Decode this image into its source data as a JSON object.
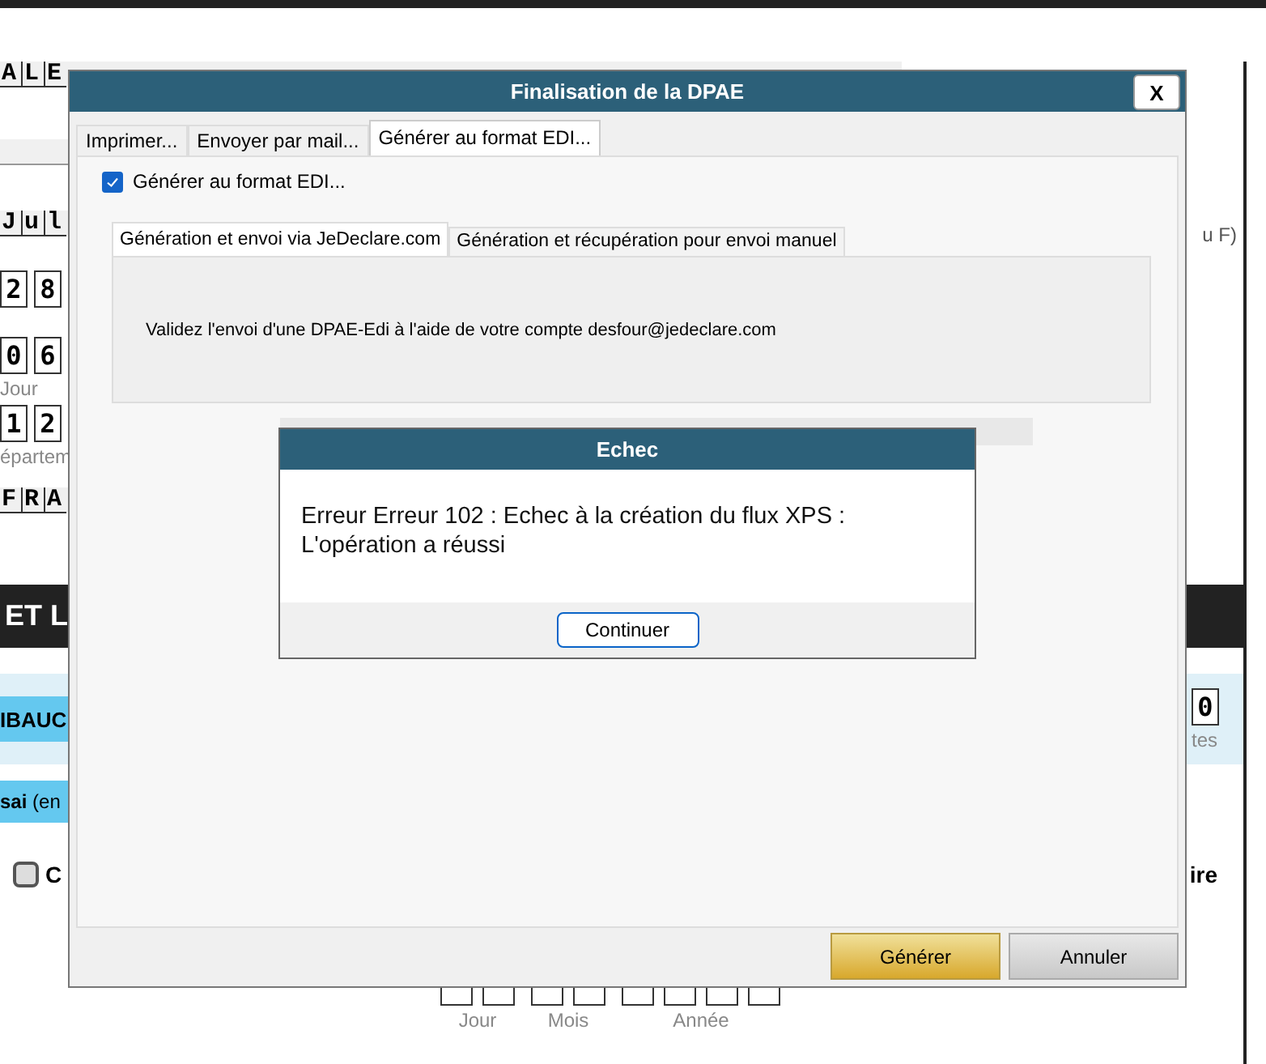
{
  "background": {
    "rows": [
      {
        "kind": "letters",
        "cells": [
          "A",
          "L",
          "E"
        ]
      },
      {
        "kind": "ruler"
      },
      {
        "kind": "letters",
        "cells": [
          "J",
          "u",
          "l"
        ],
        "right": "u F)"
      },
      {
        "kind": "digits",
        "cells": [
          "2",
          "8"
        ]
      },
      {
        "kind": "digits",
        "cells": [
          "0",
          "6"
        ],
        "caption": "Jour"
      },
      {
        "kind": "digits",
        "cells": [
          "1",
          "2"
        ],
        "caption": "épartem"
      },
      {
        "kind": "letters",
        "cells": [
          "F",
          "R",
          "A"
        ]
      },
      {
        "kind": "band",
        "text": "ET L"
      },
      {
        "kind": "blue-band",
        "text": "IBAUC",
        "right_cells": [
          "0"
        ],
        "right_caption": "tes"
      },
      {
        "kind": "blue-bar",
        "text": "**sai** (en"
      },
      {
        "kind": "option",
        "text": "C",
        "checked": false,
        "right": "ire"
      },
      {
        "kind": "date",
        "captions": [
          "Jour",
          "Mois",
          "Année"
        ]
      }
    ]
  },
  "dialog": {
    "title": "Finalisation de la DPAE",
    "close": "X",
    "tabs": [
      {
        "label": "Imprimer...",
        "selected": false
      },
      {
        "label": "Envoyer par mail...",
        "selected": false
      },
      {
        "label": "Générer au format EDI...",
        "selected": true
      }
    ],
    "checkbox": {
      "label": "Générer au format EDI...",
      "checked": true
    },
    "inner_tabs": [
      {
        "label": "Génération et envoi via JeDeclare.com",
        "selected": true
      },
      {
        "label": "Génération et récupération pour envoi manuel",
        "selected": false
      }
    ],
    "message": "Validez l'envoi d'une DPAE-Edi à l'aide de votre compte desfour@jedeclare.com",
    "buttons": [
      {
        "label": "Générer",
        "kind": "primary"
      },
      {
        "label": "Annuler",
        "kind": "secondary"
      }
    ]
  },
  "error_dialog": {
    "title": "Echec",
    "message": "Erreur Erreur 102 : Echec à la création du flux XPS : L'opération a réussi",
    "button": "Continuer"
  }
}
